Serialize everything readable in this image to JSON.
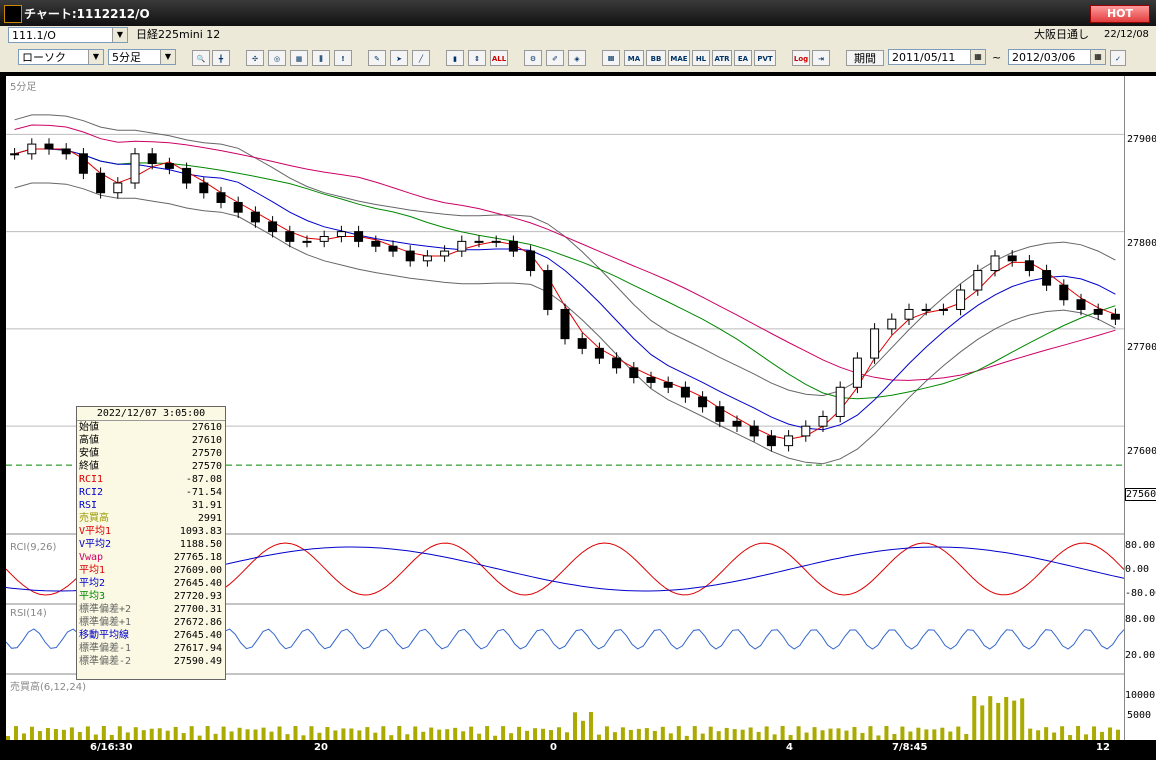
{
  "window": {
    "title": "チャート:1112212/O",
    "hot_badge": "HOT"
  },
  "toolbar1": {
    "symbol": "111.1/O",
    "name": "日経225mini 12",
    "session": "大阪日通し",
    "date": "22/12/08"
  },
  "toolbar2": {
    "chart_type": "ローソク",
    "interval": "5分足",
    "indicator_buttons": [
      "MA",
      "BB",
      "MAE",
      "HL",
      "ATR",
      "EA",
      "PVT",
      "Log"
    ],
    "period_label": "期間",
    "period_from": "2011/05/11",
    "period_to": "2012/03/06",
    "range_sep": "~"
  },
  "panels": {
    "main": "5分足",
    "rci": "RCI(9,26)",
    "rsi": "RSI(14)",
    "volume": "売買高(6,12,24)"
  },
  "yaxis_main": [
    "27900",
    "27800",
    "27700",
    "27600"
  ],
  "current_price": "27560",
  "yaxis_rci": [
    "80.00",
    "0.00",
    "-80.00"
  ],
  "yaxis_rsi": [
    "80.00",
    "20.00"
  ],
  "yaxis_vol": [
    "10000",
    "5000"
  ],
  "xaxis": [
    "6/16:30",
    "20",
    "0",
    "4",
    "7/8:45",
    "12"
  ],
  "info": {
    "datetime": "2022/12/07 3:05:00",
    "rows": [
      {
        "k": "始値",
        "v": "27610",
        "c": "#000"
      },
      {
        "k": "高値",
        "v": "27610",
        "c": "#000"
      },
      {
        "k": "安値",
        "v": "27570",
        "c": "#000"
      },
      {
        "k": "終値",
        "v": "27570",
        "c": "#000"
      },
      {
        "k": "RCI1",
        "v": "-87.08",
        "c": "#d00"
      },
      {
        "k": "RCI2",
        "v": "-71.54",
        "c": "#00c"
      },
      {
        "k": "RSI",
        "v": "31.91",
        "c": "#00c"
      },
      {
        "k": "売買高",
        "v": "2991",
        "c": "#990"
      },
      {
        "k": "V平均1",
        "v": "1093.83",
        "c": "#d00"
      },
      {
        "k": "V平均2",
        "v": "1188.50",
        "c": "#00c"
      },
      {
        "k": "Vwap",
        "v": "27765.18",
        "c": "#c06"
      },
      {
        "k": "平均1",
        "v": "27609.00",
        "c": "#d00"
      },
      {
        "k": "平均2",
        "v": "27645.40",
        "c": "#00c"
      },
      {
        "k": "平均3",
        "v": "27720.93",
        "c": "#080"
      },
      {
        "k": "標準偏差+2",
        "v": "27700.31",
        "c": "#666"
      },
      {
        "k": "標準偏差+1",
        "v": "27672.86",
        "c": "#666"
      },
      {
        "k": "移動平均線",
        "v": "27645.40",
        "c": "#00c"
      },
      {
        "k": "標準偏差-1",
        "v": "27617.94",
        "c": "#666"
      },
      {
        "k": "標準偏差-2",
        "v": "27590.49",
        "c": "#666"
      }
    ]
  },
  "colors": {
    "ma1": "#d00",
    "ma2": "#00c",
    "ma3": "#080",
    "vwap": "#c06",
    "band": "#666",
    "rci1": "#d00",
    "rci2": "#00c",
    "rsi": "#36c",
    "volume": "#aa0"
  },
  "chart_data": {
    "type": "candlestick",
    "ylim": [
      27520,
      27960
    ],
    "series": [
      {
        "name": "price",
        "values": [
          27880,
          27890,
          27885,
          27880,
          27860,
          27840,
          27850,
          27880,
          27870,
          27865,
          27850,
          27840,
          27830,
          27820,
          27810,
          27800,
          27790,
          27790,
          27795,
          27800,
          27790,
          27785,
          27780,
          27770,
          27775,
          27780,
          27790,
          27790,
          27790,
          27780,
          27760,
          27720,
          27690,
          27680,
          27670,
          27660,
          27650,
          27645,
          27640,
          27630,
          27620,
          27605,
          27600,
          27590,
          27580,
          27590,
          27600,
          27610,
          27640,
          27670,
          27700,
          27710,
          27720,
          27720,
          27720,
          27740,
          27760,
          27775,
          27770,
          27760,
          27745,
          27730,
          27720,
          27715,
          27710
        ]
      }
    ]
  }
}
